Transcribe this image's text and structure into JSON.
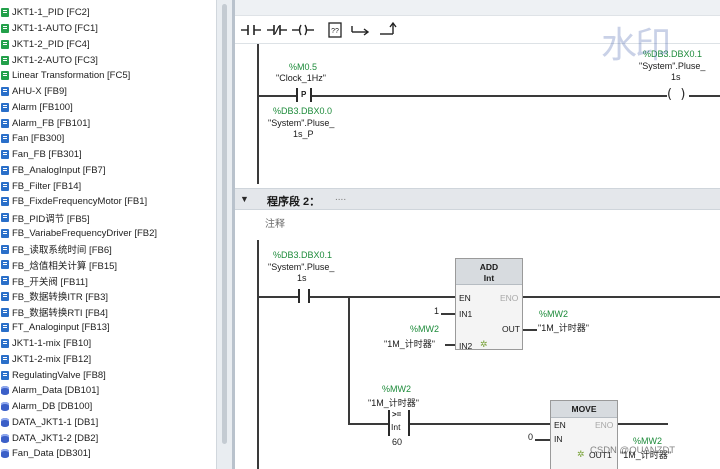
{
  "tree": {
    "items": [
      {
        "label": "JKT1-1_PID [FC2]",
        "kind": "fc"
      },
      {
        "label": "JKT1-1-AUTO [FC1]",
        "kind": "fc"
      },
      {
        "label": "JKT1-2_PID [FC4]",
        "kind": "fc"
      },
      {
        "label": "JKT1-2-AUTO [FC3]",
        "kind": "fc"
      },
      {
        "label": "Linear Transformation [FC5]",
        "kind": "fc"
      },
      {
        "label": "AHU-X [FB9]",
        "kind": "fb"
      },
      {
        "label": "Alarm [FB100]",
        "kind": "fb"
      },
      {
        "label": "Alarm_FB [FB101]",
        "kind": "fb"
      },
      {
        "label": "Fan [FB300]",
        "kind": "fb"
      },
      {
        "label": "Fan_FB [FB301]",
        "kind": "fb"
      },
      {
        "label": "FB_AnalogInput [FB7]",
        "kind": "fb"
      },
      {
        "label": "FB_Filter [FB14]",
        "kind": "fb"
      },
      {
        "label": "FB_FixdeFrequencyMotor [FB1]",
        "kind": "fb"
      },
      {
        "label": "FB_PID调节 [FB5]",
        "kind": "fb"
      },
      {
        "label": "FB_VariabeFrequencyDriver [FB2]",
        "kind": "fb"
      },
      {
        "label": "FB_读取系统时间 [FB6]",
        "kind": "fb"
      },
      {
        "label": "FB_焓值相关计算 [FB15]",
        "kind": "fb"
      },
      {
        "label": "FB_开关阀 [FB11]",
        "kind": "fb"
      },
      {
        "label": "FB_数据转换ITR [FB3]",
        "kind": "fb"
      },
      {
        "label": "FB_数据转换RTI [FB4]",
        "kind": "fb"
      },
      {
        "label": "FT_Analoginput [FB13]",
        "kind": "fb"
      },
      {
        "label": "JKT1-1-mix [FB10]",
        "kind": "fb"
      },
      {
        "label": "JKT1-2-mix [FB12]",
        "kind": "fb"
      },
      {
        "label": "RegulatingValve [FB8]",
        "kind": "fb"
      },
      {
        "label": "Alarm_Data [DB101]",
        "kind": "db"
      },
      {
        "label": "Alarm_DB [DB100]",
        "kind": "db"
      },
      {
        "label": "DATA_JKT1-1 [DB1]",
        "kind": "db"
      },
      {
        "label": "DATA_JKT1-2 [DB2]",
        "kind": "db"
      },
      {
        "label": "Fan_Data [DB301]",
        "kind": "db"
      }
    ]
  },
  "toolbar": {
    "icons": [
      "no-contact-icon",
      "nc-contact-icon",
      "coil-icon",
      "empty-box-icon",
      "open-branch-icon",
      "close-branch-icon"
    ]
  },
  "network1": {
    "contact1": {
      "address": "%M0.5",
      "symbol": "\"Clock_1Hz\"",
      "type": "P"
    },
    "edge_mem": {
      "address": "%DB3.DBX0.0",
      "symbol": "\"System\".Pluse_",
      "symbol2": "1s_P"
    },
    "coil": {
      "address": "%DB3.DBX0.1",
      "symbol": "\"System\".Pluse_",
      "symbol2": "1s"
    }
  },
  "network2": {
    "header": {
      "title": "程序段 2：",
      "dots": "....",
      "comment": "注释"
    },
    "contact": {
      "address": "%DB3.DBX0.1",
      "symbol": "\"System\".Pluse_",
      "symbol2": "1s"
    },
    "add": {
      "title": "ADD",
      "type": "Int",
      "en": "EN",
      "eno": "ENO",
      "in1": "IN1",
      "in2": "IN2",
      "out": "OUT",
      "in1_value": "1",
      "in2_address": "%MW2",
      "in2_symbol": "\"1M_计时器\"",
      "out_address": "%MW2",
      "out_symbol": "\"1M_计时器\""
    },
    "cmp": {
      "address": "%MW2",
      "symbol": "\"1M_计时器\"",
      "op": ">=",
      "type": "Int",
      "value": "60"
    },
    "move": {
      "title": "MOVE",
      "en": "EN",
      "eno": "ENO",
      "in": "IN",
      "out": "OUT1",
      "in_value": "0",
      "out_address": "%MW2",
      "out_symbol": "\"1M_计时器\""
    }
  },
  "watermark": {
    "text": "水印",
    "credit": "CSDN @QUANZDT"
  }
}
